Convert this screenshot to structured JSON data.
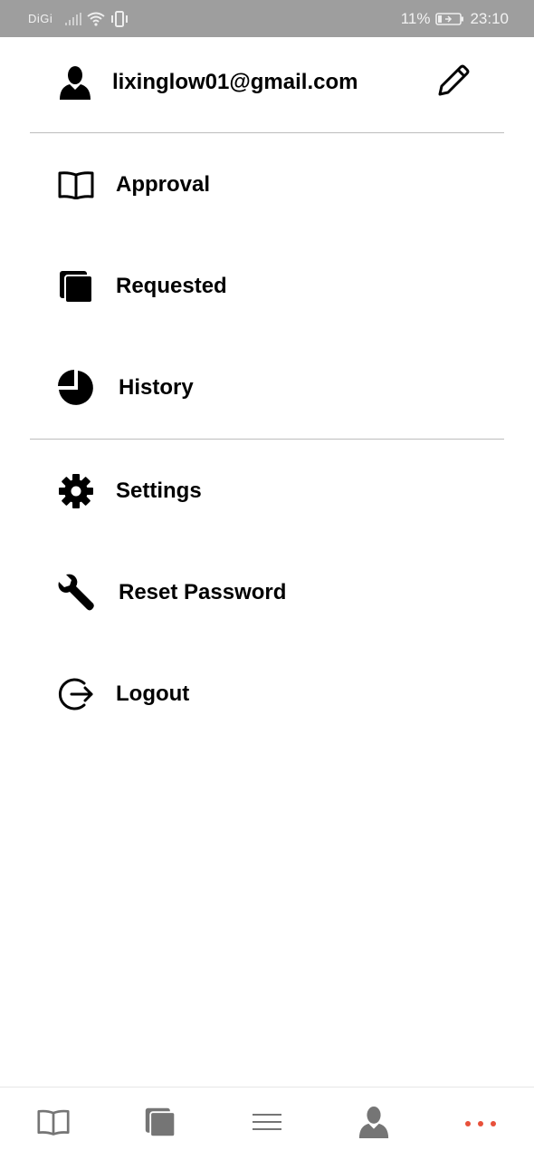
{
  "status_bar": {
    "carrier": "DiGi",
    "battery_percent": "11%",
    "time": "23:10",
    "icons": [
      "signal-icon",
      "wifi-icon",
      "vibrate-icon",
      "battery-charging-icon"
    ]
  },
  "user": {
    "email": "lixinglow01@gmail.com",
    "avatar_icon": "user-icon",
    "edit_icon": "pencil-icon"
  },
  "menu": {
    "group1": [
      {
        "label": "Approval",
        "icon": "book-open-icon"
      },
      {
        "label": "Requested",
        "icon": "copy-icon"
      },
      {
        "label": "History",
        "icon": "pie-chart-icon"
      }
    ],
    "group2": [
      {
        "label": "Settings",
        "icon": "gear-icon"
      },
      {
        "label": "Reset Password",
        "icon": "wrench-icon"
      },
      {
        "label": "Logout",
        "icon": "logout-icon"
      }
    ]
  },
  "bottom_nav": {
    "items": [
      {
        "icon": "book-open-icon"
      },
      {
        "icon": "copy-icon"
      },
      {
        "icon": "menu-icon"
      },
      {
        "icon": "user-icon"
      },
      {
        "icon": "more-icon",
        "active": true
      }
    ],
    "active_color": "#e8503a",
    "inactive_color": "#757575"
  }
}
